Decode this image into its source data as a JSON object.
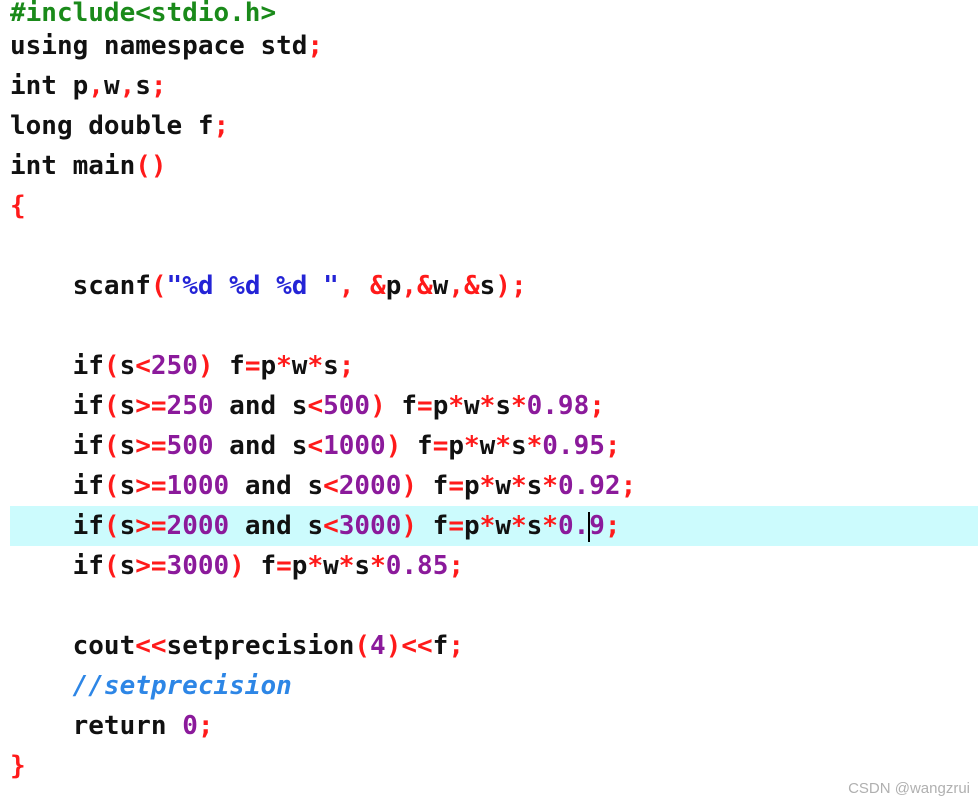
{
  "editor": {
    "lines": [
      {
        "tokens": [
          {
            "t": "#include<stdio.h>",
            "c": "pp"
          }
        ]
      },
      {
        "tokens": [
          {
            "t": "using namespace std",
            "c": "kw"
          },
          {
            "t": ";",
            "c": "op"
          }
        ]
      },
      {
        "tokens": [
          {
            "t": "int p",
            "c": "kw"
          },
          {
            "t": ",",
            "c": "op"
          },
          {
            "t": "w",
            "c": "id"
          },
          {
            "t": ",",
            "c": "op"
          },
          {
            "t": "s",
            "c": "id"
          },
          {
            "t": ";",
            "c": "op"
          }
        ]
      },
      {
        "tokens": [
          {
            "t": "long double f",
            "c": "kw"
          },
          {
            "t": ";",
            "c": "op"
          }
        ]
      },
      {
        "tokens": [
          {
            "t": "int main",
            "c": "kw"
          },
          {
            "t": "()",
            "c": "op"
          }
        ]
      },
      {
        "tokens": [
          {
            "t": "{",
            "c": "op"
          }
        ]
      },
      {
        "tokens": []
      },
      {
        "tokens": [
          {
            "t": "    scanf",
            "c": "id"
          },
          {
            "t": "(",
            "c": "op"
          },
          {
            "t": "\"%d %d %d \"",
            "c": "str"
          },
          {
            "t": ", &",
            "c": "op"
          },
          {
            "t": "p",
            "c": "id"
          },
          {
            "t": ",&",
            "c": "op"
          },
          {
            "t": "w",
            "c": "id"
          },
          {
            "t": ",&",
            "c": "op"
          },
          {
            "t": "s",
            "c": "id"
          },
          {
            "t": ");",
            "c": "op"
          }
        ]
      },
      {
        "tokens": []
      },
      {
        "tokens": [
          {
            "t": "    if",
            "c": "kw"
          },
          {
            "t": "(",
            "c": "op"
          },
          {
            "t": "s",
            "c": "id"
          },
          {
            "t": "<",
            "c": "op"
          },
          {
            "t": "250",
            "c": "num"
          },
          {
            "t": ")",
            "c": "op"
          },
          {
            "t": " f",
            "c": "id"
          },
          {
            "t": "=",
            "c": "op"
          },
          {
            "t": "p",
            "c": "id"
          },
          {
            "t": "*",
            "c": "op"
          },
          {
            "t": "w",
            "c": "id"
          },
          {
            "t": "*",
            "c": "op"
          },
          {
            "t": "s",
            "c": "id"
          },
          {
            "t": ";",
            "c": "op"
          }
        ]
      },
      {
        "tokens": [
          {
            "t": "    if",
            "c": "kw"
          },
          {
            "t": "(",
            "c": "op"
          },
          {
            "t": "s",
            "c": "id"
          },
          {
            "t": ">=",
            "c": "op"
          },
          {
            "t": "250",
            "c": "num"
          },
          {
            "t": " and s",
            "c": "kw"
          },
          {
            "t": "<",
            "c": "op"
          },
          {
            "t": "500",
            "c": "num"
          },
          {
            "t": ")",
            "c": "op"
          },
          {
            "t": " f",
            "c": "id"
          },
          {
            "t": "=",
            "c": "op"
          },
          {
            "t": "p",
            "c": "id"
          },
          {
            "t": "*",
            "c": "op"
          },
          {
            "t": "w",
            "c": "id"
          },
          {
            "t": "*",
            "c": "op"
          },
          {
            "t": "s",
            "c": "id"
          },
          {
            "t": "*",
            "c": "op"
          },
          {
            "t": "0.98",
            "c": "num"
          },
          {
            "t": ";",
            "c": "op"
          }
        ]
      },
      {
        "tokens": [
          {
            "t": "    if",
            "c": "kw"
          },
          {
            "t": "(",
            "c": "op"
          },
          {
            "t": "s",
            "c": "id"
          },
          {
            "t": ">=",
            "c": "op"
          },
          {
            "t": "500",
            "c": "num"
          },
          {
            "t": " and s",
            "c": "kw"
          },
          {
            "t": "<",
            "c": "op"
          },
          {
            "t": "1000",
            "c": "num"
          },
          {
            "t": ")",
            "c": "op"
          },
          {
            "t": " f",
            "c": "id"
          },
          {
            "t": "=",
            "c": "op"
          },
          {
            "t": "p",
            "c": "id"
          },
          {
            "t": "*",
            "c": "op"
          },
          {
            "t": "w",
            "c": "id"
          },
          {
            "t": "*",
            "c": "op"
          },
          {
            "t": "s",
            "c": "id"
          },
          {
            "t": "*",
            "c": "op"
          },
          {
            "t": "0.95",
            "c": "num"
          },
          {
            "t": ";",
            "c": "op"
          }
        ]
      },
      {
        "tokens": [
          {
            "t": "    if",
            "c": "kw"
          },
          {
            "t": "(",
            "c": "op"
          },
          {
            "t": "s",
            "c": "id"
          },
          {
            "t": ">=",
            "c": "op"
          },
          {
            "t": "1000",
            "c": "num"
          },
          {
            "t": " and s",
            "c": "kw"
          },
          {
            "t": "<",
            "c": "op"
          },
          {
            "t": "2000",
            "c": "num"
          },
          {
            "t": ")",
            "c": "op"
          },
          {
            "t": " f",
            "c": "id"
          },
          {
            "t": "=",
            "c": "op"
          },
          {
            "t": "p",
            "c": "id"
          },
          {
            "t": "*",
            "c": "op"
          },
          {
            "t": "w",
            "c": "id"
          },
          {
            "t": "*",
            "c": "op"
          },
          {
            "t": "s",
            "c": "id"
          },
          {
            "t": "*",
            "c": "op"
          },
          {
            "t": "0.92",
            "c": "num"
          },
          {
            "t": ";",
            "c": "op"
          }
        ]
      },
      {
        "current": true,
        "tokens": [
          {
            "t": "    if",
            "c": "kw"
          },
          {
            "t": "(",
            "c": "op"
          },
          {
            "t": "s",
            "c": "id"
          },
          {
            "t": ">=",
            "c": "op"
          },
          {
            "t": "2000",
            "c": "num"
          },
          {
            "t": " and s",
            "c": "kw"
          },
          {
            "t": "<",
            "c": "op"
          },
          {
            "t": "3000",
            "c": "num"
          },
          {
            "t": ")",
            "c": "op"
          },
          {
            "t": " f",
            "c": "id"
          },
          {
            "t": "=",
            "c": "op"
          },
          {
            "t": "p",
            "c": "id"
          },
          {
            "t": "*",
            "c": "op"
          },
          {
            "t": "w",
            "c": "id"
          },
          {
            "t": "*",
            "c": "op"
          },
          {
            "t": "s",
            "c": "id"
          },
          {
            "t": "*",
            "c": "op"
          },
          {
            "t": "0.",
            "c": "num"
          },
          {
            "t": "|",
            "c": "caret"
          },
          {
            "t": "9",
            "c": "num"
          },
          {
            "t": ";",
            "c": "op"
          }
        ]
      },
      {
        "tokens": [
          {
            "t": "    if",
            "c": "kw"
          },
          {
            "t": "(",
            "c": "op"
          },
          {
            "t": "s",
            "c": "id"
          },
          {
            "t": ">=",
            "c": "op"
          },
          {
            "t": "3000",
            "c": "num"
          },
          {
            "t": ")",
            "c": "op"
          },
          {
            "t": " f",
            "c": "id"
          },
          {
            "t": "=",
            "c": "op"
          },
          {
            "t": "p",
            "c": "id"
          },
          {
            "t": "*",
            "c": "op"
          },
          {
            "t": "w",
            "c": "id"
          },
          {
            "t": "*",
            "c": "op"
          },
          {
            "t": "s",
            "c": "id"
          },
          {
            "t": "*",
            "c": "op"
          },
          {
            "t": "0.85",
            "c": "num"
          },
          {
            "t": ";",
            "c": "op"
          }
        ]
      },
      {
        "tokens": []
      },
      {
        "tokens": [
          {
            "t": "    cout",
            "c": "id"
          },
          {
            "t": "<<",
            "c": "op"
          },
          {
            "t": "setprecision",
            "c": "id"
          },
          {
            "t": "(",
            "c": "op"
          },
          {
            "t": "4",
            "c": "num"
          },
          {
            "t": ")<<",
            "c": "op"
          },
          {
            "t": "f",
            "c": "id"
          },
          {
            "t": ";",
            "c": "op"
          }
        ]
      },
      {
        "tokens": [
          {
            "t": "    //setprecision",
            "c": "cm"
          }
        ]
      },
      {
        "tokens": [
          {
            "t": "    return ",
            "c": "kw"
          },
          {
            "t": "0",
            "c": "num"
          },
          {
            "t": ";",
            "c": "op"
          }
        ]
      },
      {
        "tokens": [
          {
            "t": "}",
            "c": "op"
          }
        ]
      }
    ]
  },
  "watermark": "CSDN @wangzrui",
  "colors": {
    "current_line_bg": "#ccfbfd",
    "preprocessor": "#1a8a1a",
    "operator": "#ff1a1a",
    "number": "#8b1a9b",
    "string": "#2424d6",
    "comment": "#2d86e6"
  }
}
